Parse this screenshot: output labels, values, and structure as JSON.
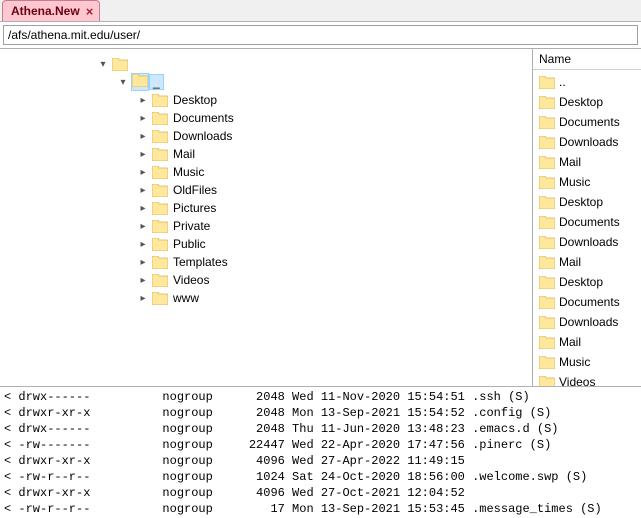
{
  "tab": {
    "title": "Athena.New"
  },
  "address": {
    "value": "/afs/athena.mit.edu/user/"
  },
  "tree": {
    "root": {
      "expanded": true,
      "children": [
        {
          "label": "_",
          "expanded": true,
          "selected": true,
          "children": [
            {
              "label": "Desktop"
            },
            {
              "label": "Documents"
            },
            {
              "label": "Downloads"
            },
            {
              "label": "Mail"
            },
            {
              "label": "Music"
            },
            {
              "label": "OldFiles"
            },
            {
              "label": "Pictures"
            },
            {
              "label": "Private"
            },
            {
              "label": "Public"
            },
            {
              "label": "Templates"
            },
            {
              "label": "Videos"
            },
            {
              "label": "www"
            }
          ]
        }
      ]
    }
  },
  "list": {
    "header": "Name",
    "items": [
      {
        "name": ".."
      },
      {
        "name": "Desktop"
      },
      {
        "name": "Documents"
      },
      {
        "name": "Downloads"
      },
      {
        "name": "Mail"
      },
      {
        "name": "Music"
      },
      {
        "name": "Desktop"
      },
      {
        "name": "Documents"
      },
      {
        "name": "Downloads"
      },
      {
        "name": "Mail"
      },
      {
        "name": "Desktop"
      },
      {
        "name": "Documents"
      },
      {
        "name": "Downloads"
      },
      {
        "name": "Mail"
      },
      {
        "name": "Music"
      },
      {
        "name": "Videos"
      }
    ]
  },
  "terminal": {
    "lines": [
      "< drwx------          nogroup      2048 Wed 11-Nov-2020 15:54:51 .ssh (S)",
      "< drwxr-xr-x          nogroup      2048 Mon 13-Sep-2021 15:54:52 .config (S)",
      "< drwx------          nogroup      2048 Thu 11-Jun-2020 13:48:23 .emacs.d (S)",
      "< -rw-------          nogroup     22447 Wed 22-Apr-2020 17:47:56 .pinerc (S)",
      "< drwxr-xr-x          nogroup      4096 Wed 27-Apr-2022 11:49:15",
      "< -rw-r--r--          nogroup      1024 Sat 24-Oct-2020 18:56:00 .welcome.swp (S)",
      "< drwxr-xr-x          nogroup      4096 Wed 27-Oct-2021 12:04:52",
      "< -rw-r--r--          nogroup        17 Mon 13-Sep-2021 15:53:45 .message_times (S)"
    ]
  }
}
